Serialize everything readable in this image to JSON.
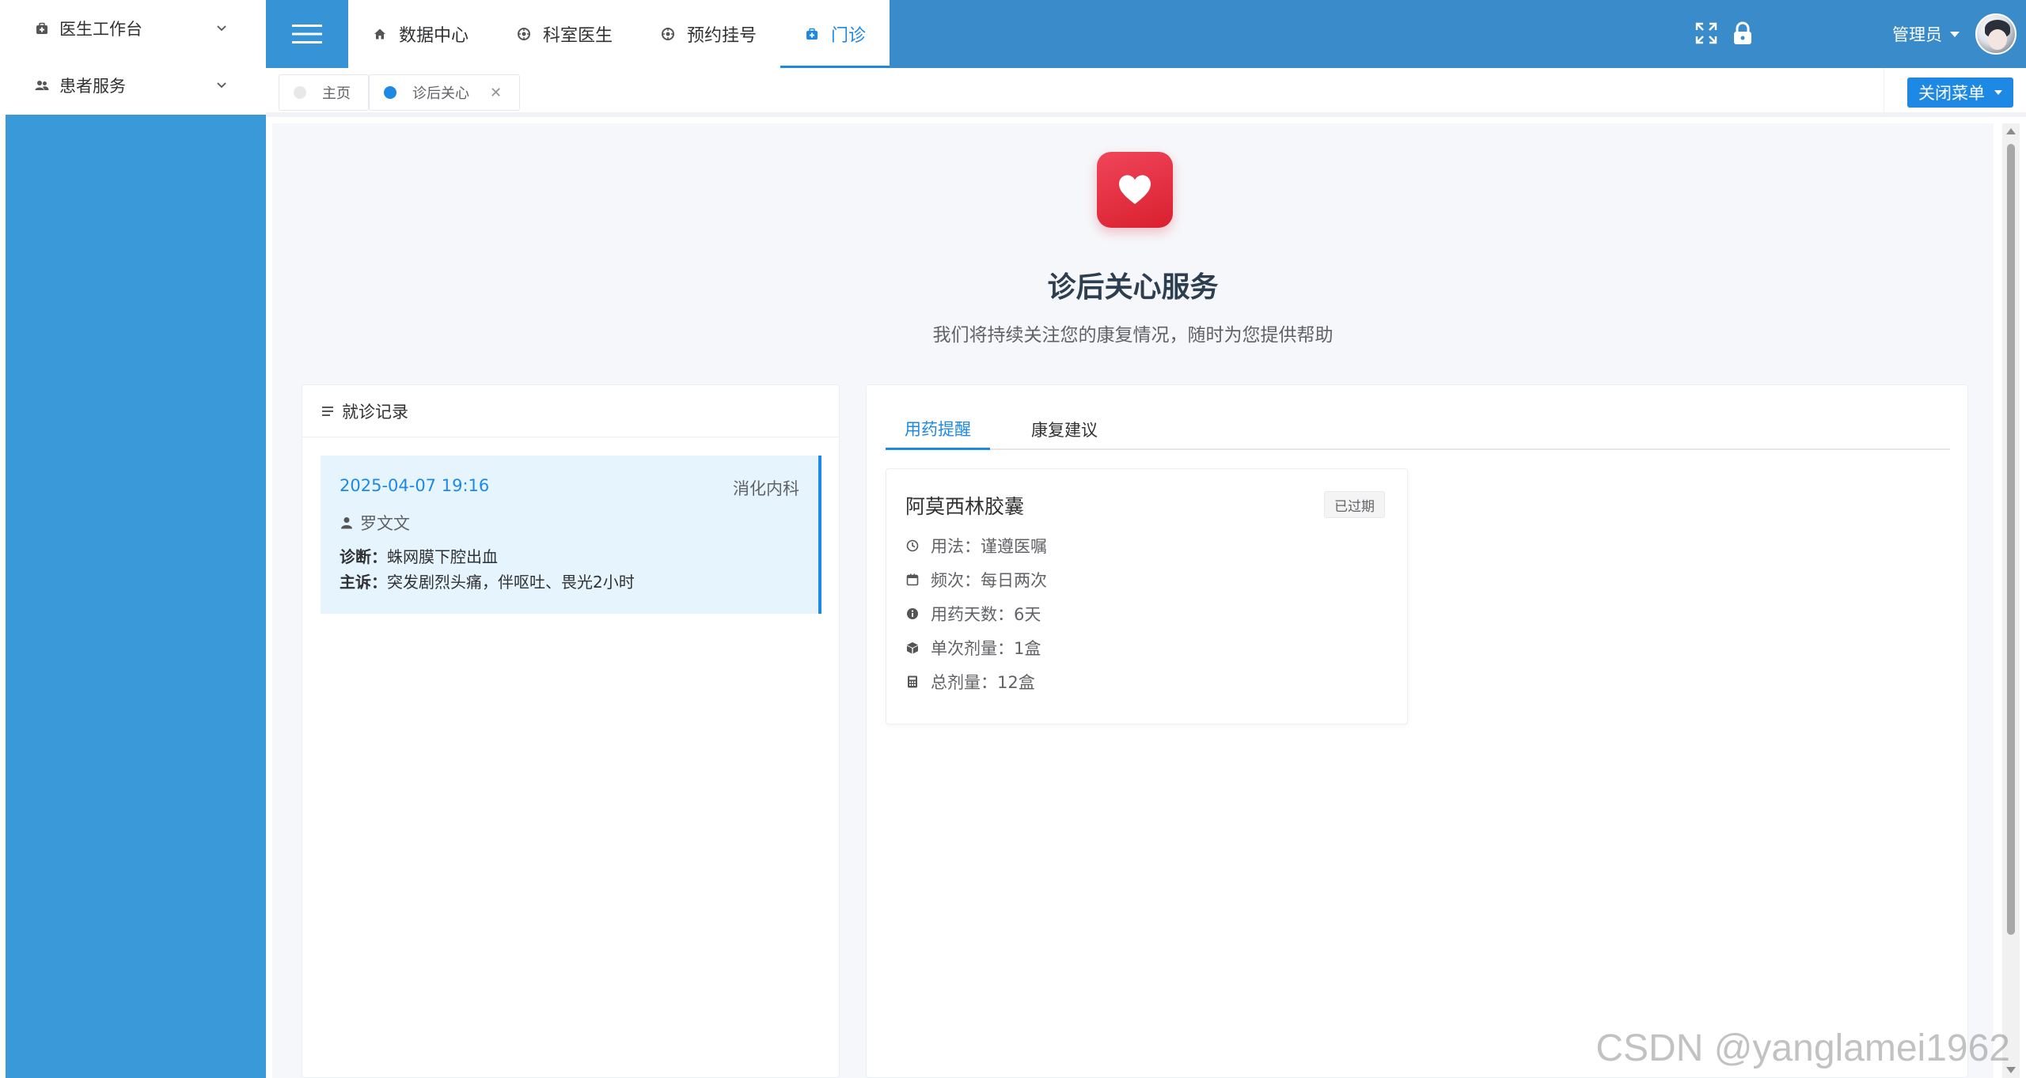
{
  "sidebar": {
    "items": [
      {
        "label": "医生工作台",
        "icon": "medkit-icon"
      },
      {
        "label": "患者服务",
        "icon": "users-icon"
      }
    ]
  },
  "header": {
    "nav": [
      {
        "label": "数据中心",
        "icon": "home-icon"
      },
      {
        "label": "科室医生",
        "icon": "settings-icon"
      },
      {
        "label": "预约挂号",
        "icon": "settings-icon"
      },
      {
        "label": "门诊",
        "icon": "medkit-icon",
        "active": true
      }
    ],
    "user": {
      "name": "管理员"
    }
  },
  "tabs": {
    "items": [
      {
        "label": "主页"
      },
      {
        "label": "诊后关心",
        "active": true
      }
    ],
    "close_menu_label": "关闭菜单"
  },
  "hero": {
    "title": "诊后关心服务",
    "subtitle": "我们将持续关注您的康复情况，随时为您提供帮助"
  },
  "records": {
    "header": "就诊记录",
    "items": [
      {
        "datetime": "2025-04-07 19:16",
        "department": "消化内科",
        "doctor": "罗文文",
        "diagnosis_label": "诊断：",
        "diagnosis": "蛛网膜下腔出血",
        "complaint_label": "主诉：",
        "complaint": "突发剧烈头痛，伴呕吐、畏光2小时"
      }
    ]
  },
  "detail": {
    "tabs": [
      {
        "label": "用药提醒",
        "active": true
      },
      {
        "label": "康复建议"
      }
    ],
    "medication": {
      "name": "阿莫西林胶囊",
      "status": "已过期",
      "rows": [
        {
          "label": "用法：",
          "value": "谨遵医嘱",
          "icon": "clock-icon"
        },
        {
          "label": "频次：",
          "value": "每日两次",
          "icon": "calendar-icon"
        },
        {
          "label": "用药天数：",
          "value": "6天",
          "icon": "info-icon"
        },
        {
          "label": "单次剂量：",
          "value": "1盒",
          "icon": "box-icon"
        },
        {
          "label": "总剂量：",
          "value": "12盒",
          "icon": "calculator-icon"
        }
      ]
    }
  },
  "watermark": "CSDN @yanglamei1962",
  "colors": {
    "primary": "#1e88e5",
    "header": "#3a8bc9",
    "sidebar": "#3a99d8",
    "heart": "#e62e40"
  }
}
